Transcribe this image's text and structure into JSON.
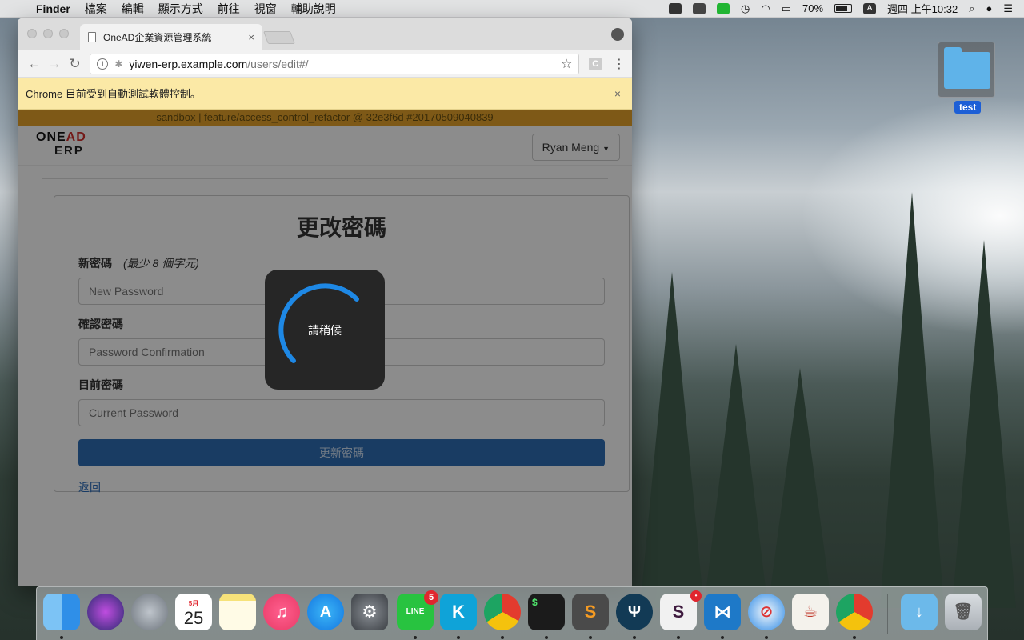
{
  "menubar": {
    "app_name": "Finder",
    "menus": [
      "檔案",
      "編輯",
      "顯示方式",
      "前往",
      "視窗",
      "輔助說明"
    ],
    "battery_percent": "70%",
    "input_source": "A",
    "clock": "週四 上午10:32"
  },
  "browser": {
    "tab_title": "OneAD企業資源管理系統",
    "tab_close": "×",
    "url_host": "yiwen-erp.example.com",
    "url_path": "/users/edit#/",
    "infobar_text": "Chrome 目前受到自動測試軟體控制。",
    "infobar_close": "×"
  },
  "page": {
    "env_banner": "sandbox | feature/access_control_refactor @ 32e3f6d #20170509040839",
    "logo_line1_a": "ONE",
    "logo_line1_b": "AD",
    "logo_line2": "ERP",
    "user_menu": "Ryan Meng",
    "heading": "更改密碼",
    "fields": [
      {
        "label": "新密碼",
        "hint": "(最少 8 個字元)",
        "placeholder": "New Password"
      },
      {
        "label": "確認密碼",
        "hint": "",
        "placeholder": "Password Confirmation"
      },
      {
        "label": "目前密碼",
        "hint": "",
        "placeholder": "Current Password"
      }
    ],
    "submit_label": "更新密碼",
    "back_link": "返回",
    "loading_text": "請稍候"
  },
  "desktop": {
    "folder_name": "test"
  },
  "dock": {
    "calendar_month": "5月",
    "calendar_day": "25",
    "line_badge": "5",
    "line_label": "LINE"
  },
  "colors": {
    "env_banner": "#e6a32b",
    "infobar": "#fbe9a6",
    "primary_button": "#2f6db5",
    "link": "#2a6bb8",
    "spinner": "#1e88e5"
  }
}
